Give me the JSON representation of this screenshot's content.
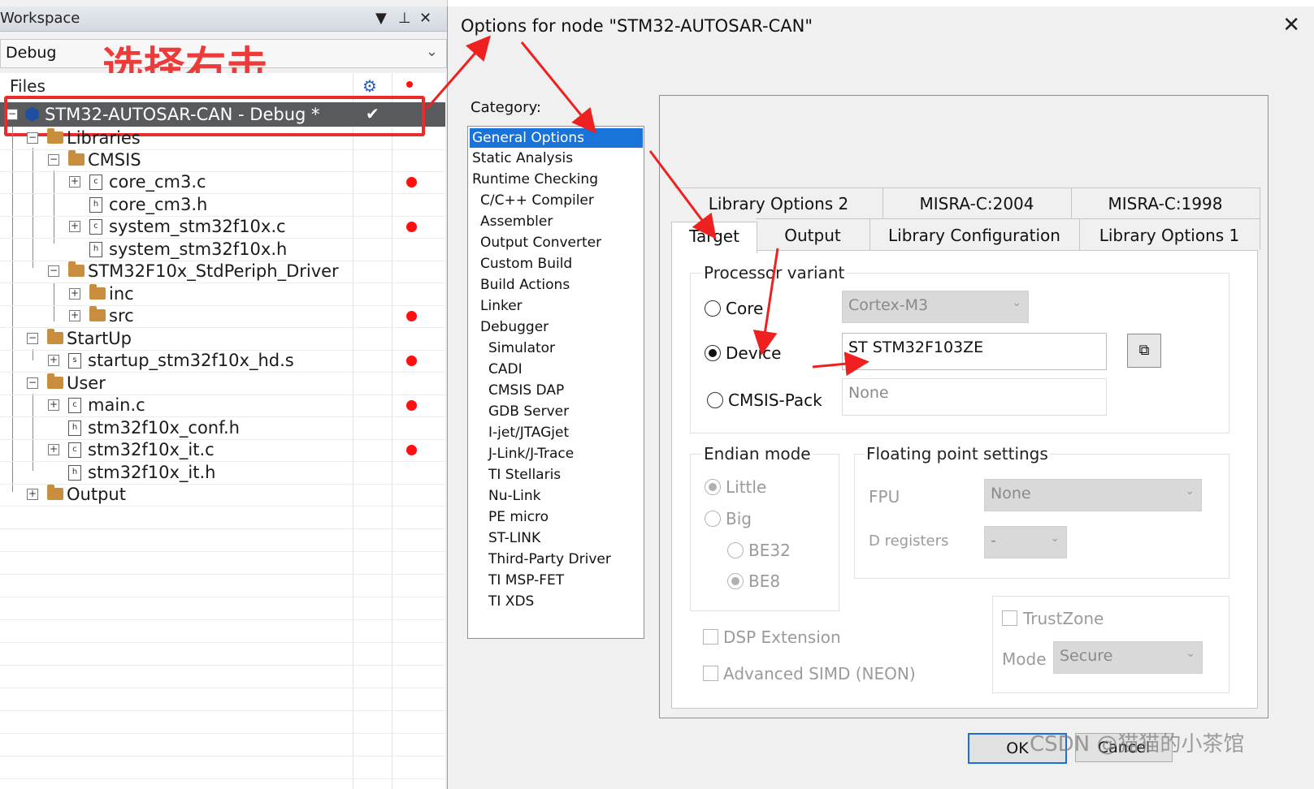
{
  "workspace": {
    "title": "Workspace",
    "config": "Debug",
    "files_header": "Files",
    "annotation": "选择右击",
    "project": "STM32-AUTOSAR-CAN - Debug *",
    "tree": [
      {
        "label": "Libraries"
      },
      {
        "label": "CMSIS"
      },
      {
        "label": "core_cm3.c"
      },
      {
        "label": "core_cm3.h"
      },
      {
        "label": "system_stm32f10x.c"
      },
      {
        "label": "system_stm32f10x.h"
      },
      {
        "label": "STM32F10x_StdPeriph_Driver"
      },
      {
        "label": "inc"
      },
      {
        "label": "src"
      },
      {
        "label": "StartUp"
      },
      {
        "label": "startup_stm32f10x_hd.s"
      },
      {
        "label": "User"
      },
      {
        "label": "main.c"
      },
      {
        "label": "stm32f10x_conf.h"
      },
      {
        "label": "stm32f10x_it.c"
      },
      {
        "label": "stm32f10x_it.h"
      },
      {
        "label": "Output"
      }
    ]
  },
  "dialog": {
    "title": "Options for node \"STM32-AUTOSAR-CAN\"",
    "category_label": "Category:",
    "categories": [
      "General Options",
      "Static Analysis",
      "Runtime Checking",
      "C/C++ Compiler",
      "Assembler",
      "Output Converter",
      "Custom Build",
      "Build Actions",
      "Linker",
      "Debugger",
      "Simulator",
      "CADI",
      "CMSIS DAP",
      "GDB Server",
      "I-jet/JTAGjet",
      "J-Link/J-Trace",
      "TI Stellaris",
      "Nu-Link",
      "PE micro",
      "ST-LINK",
      "Third-Party Driver",
      "TI MSP-FET",
      "TI XDS"
    ],
    "tabs_row1": [
      "Library Options 2",
      "MISRA-C:2004",
      "MISRA-C:1998"
    ],
    "tabs_row2": [
      "Target",
      "Output",
      "Library Configuration",
      "Library Options 1"
    ],
    "processor_variant": {
      "title": "Processor variant",
      "core_label": "Core",
      "core_value": "Cortex-M3",
      "device_label": "Device",
      "device_value": "ST STM32F103ZE",
      "cmsis_label": "CMSIS-Pack",
      "cmsis_value": "None"
    },
    "endian": {
      "title": "Endian mode",
      "little": "Little",
      "big": "Big",
      "be32": "BE32",
      "be8": "BE8"
    },
    "fp": {
      "title": "Floating point settings",
      "fpu_label": "FPU",
      "fpu_value": "None",
      "dreg_label": "D registers",
      "dreg_value": "-"
    },
    "trustzone": {
      "label": "TrustZone",
      "mode_label": "Mode",
      "mode_value": "Secure"
    },
    "dsp": "DSP Extension",
    "neon": "Advanced SIMD (NEON)",
    "ok": "OK",
    "cancel": "Cancel",
    "close": "✕"
  },
  "watermark": "CSDN @猫猫的小茶馆",
  "colors": {
    "selection": "#1a73d8",
    "annotation": "#ec3b3b",
    "breakpoint": "#ff1010"
  }
}
